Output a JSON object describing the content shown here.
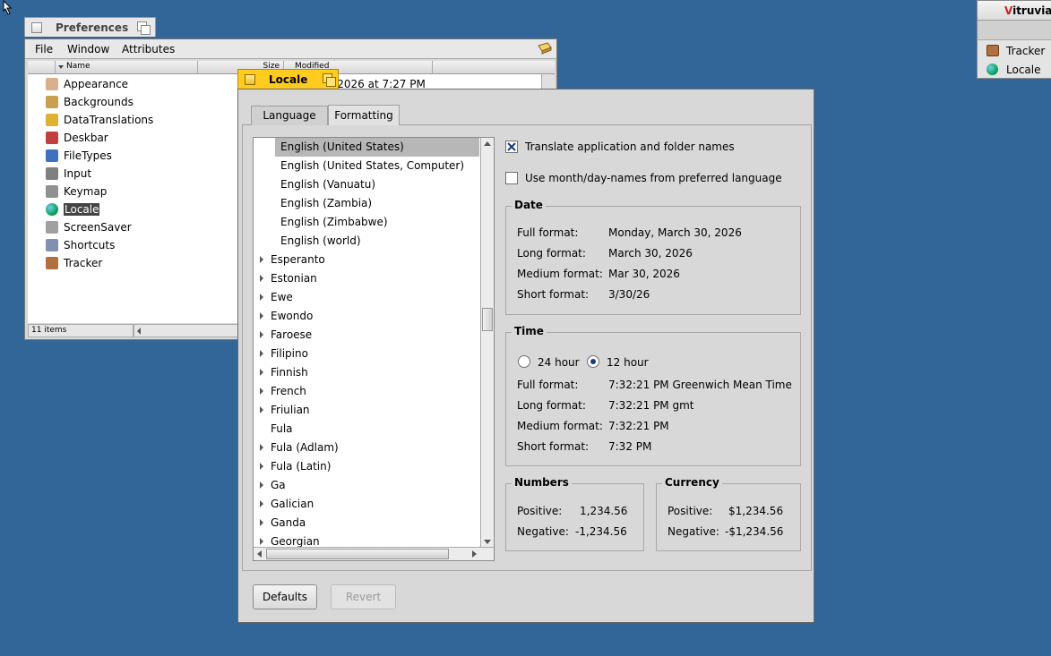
{
  "preferences": {
    "title": "Preferences",
    "menu": [
      "File",
      "Window",
      "Attributes"
    ],
    "columns": {
      "name": "Name",
      "size": "Size",
      "modified": "Modified"
    },
    "modified_value": "0, 2026 at 7:27 PM",
    "items": [
      {
        "label": "Appearance",
        "icon": "appearance-icon",
        "color": "#d9b08c"
      },
      {
        "label": "Backgrounds",
        "icon": "backgrounds-icon",
        "color": "#c8a050"
      },
      {
        "label": "DataTranslations",
        "icon": "datatranslations-icon",
        "color": "#e0b030"
      },
      {
        "label": "Deskbar",
        "icon": "deskbar-icon",
        "color": "#c04040"
      },
      {
        "label": "FileTypes",
        "icon": "filetypes-icon",
        "color": "#4070c0"
      },
      {
        "label": "Input",
        "icon": "input-icon",
        "color": "#808080"
      },
      {
        "label": "Keymap",
        "icon": "keymap-icon",
        "color": "#909090"
      },
      {
        "label": "Locale",
        "icon": "globe-icon",
        "color": "#208040"
      },
      {
        "label": "ScreenSaver",
        "icon": "screensaver-icon",
        "color": "#a0a0a0"
      },
      {
        "label": "Shortcuts",
        "icon": "shortcuts-icon",
        "color": "#8090b0"
      },
      {
        "label": "Tracker",
        "icon": "tracker-icon",
        "color": "#b07040"
      }
    ],
    "selected": "Locale",
    "status": "11 items"
  },
  "locale": {
    "title": "Locale",
    "tabs": [
      "Language",
      "Formatting"
    ],
    "active_tab": "Formatting",
    "languages": [
      {
        "label": "English (United States)",
        "indent": true,
        "arrow": false,
        "selected": true
      },
      {
        "label": "English (United States, Computer)",
        "indent": true,
        "arrow": false
      },
      {
        "label": "English (Vanuatu)",
        "indent": true,
        "arrow": false
      },
      {
        "label": "English (Zambia)",
        "indent": true,
        "arrow": false
      },
      {
        "label": "English (Zimbabwe)",
        "indent": true,
        "arrow": false
      },
      {
        "label": "English (world)",
        "indent": true,
        "arrow": false
      },
      {
        "label": "Esperanto",
        "indent": false,
        "arrow": true
      },
      {
        "label": "Estonian",
        "indent": false,
        "arrow": true
      },
      {
        "label": "Ewe",
        "indent": false,
        "arrow": true
      },
      {
        "label": "Ewondo",
        "indent": false,
        "arrow": true
      },
      {
        "label": "Faroese",
        "indent": false,
        "arrow": true
      },
      {
        "label": "Filipino",
        "indent": false,
        "arrow": true
      },
      {
        "label": "Finnish",
        "indent": false,
        "arrow": true
      },
      {
        "label": "French",
        "indent": false,
        "arrow": true
      },
      {
        "label": "Friulian",
        "indent": false,
        "arrow": true
      },
      {
        "label": "Fula",
        "indent": false,
        "arrow": false
      },
      {
        "label": "Fula (Adlam)",
        "indent": false,
        "arrow": true
      },
      {
        "label": "Fula (Latin)",
        "indent": false,
        "arrow": true
      },
      {
        "label": "Ga",
        "indent": false,
        "arrow": true
      },
      {
        "label": "Galician",
        "indent": false,
        "arrow": true
      },
      {
        "label": "Ganda",
        "indent": false,
        "arrow": true
      },
      {
        "label": "Georgian",
        "indent": false,
        "arrow": true
      }
    ],
    "translate_names": {
      "label": "Translate application and folder names",
      "checked": true
    },
    "month_names": {
      "label": "Use month/day-names from preferred language",
      "checked": false
    },
    "date": {
      "legend": "Date",
      "rows": [
        {
          "key": "Full format:",
          "value": "Monday, March 30, 2026"
        },
        {
          "key": "Long format:",
          "value": "March 30, 2026"
        },
        {
          "key": "Medium format:",
          "value": "Mar 30, 2026"
        },
        {
          "key": "Short format:",
          "value": "3/30/26"
        }
      ]
    },
    "time": {
      "legend": "Time",
      "radio_24": "24 hour",
      "radio_12": "12 hour",
      "selected": "12 hour",
      "rows": [
        {
          "key": "Full format:",
          "value": "7:32:21 PM Greenwich Mean Time"
        },
        {
          "key": "Long format:",
          "value": "7:32:21 PM gmt"
        },
        {
          "key": "Medium format:",
          "value": "7:32:21 PM"
        },
        {
          "key": "Short format:",
          "value": "7:32 PM"
        }
      ]
    },
    "numbers": {
      "legend": "Numbers",
      "positive_key": "Positive:",
      "positive": "1,234.56",
      "negative_key": "Negative:",
      "negative": "-1,234.56"
    },
    "currency": {
      "legend": "Currency",
      "positive_key": "Positive:",
      "positive": "$1,234.56",
      "negative_key": "Negative:",
      "negative": "-$1,234.56"
    },
    "defaults_label": "Defaults",
    "revert_label": "Revert"
  },
  "deskbar": {
    "title_accent": "V",
    "title_rest": "itruvian",
    "items": [
      {
        "label": "Tracker",
        "icon": "tracker-icon"
      },
      {
        "label": "Locale",
        "icon": "globe-icon"
      }
    ]
  }
}
